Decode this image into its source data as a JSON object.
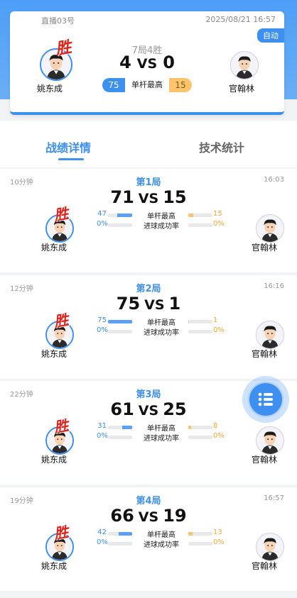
{
  "header": {
    "room": "直播03号",
    "datetime": "2025/08/21 16:57",
    "auto_badge": "自动",
    "format": "7局4胜",
    "left_player": "姚东成",
    "right_player": "官翰林",
    "left_score": "4",
    "vs": "VS",
    "right_score": "0",
    "win_mark": "胜",
    "highest_break_label": "单杆最高",
    "left_highest_break": "75",
    "right_highest_break": "15"
  },
  "tabs": [
    {
      "label": "战绩详情",
      "active": true
    },
    {
      "label": "技术统计",
      "active": false
    }
  ],
  "stat_labels": {
    "highest_break": "单杆最高",
    "pot_success": "进球成功率"
  },
  "games": [
    {
      "title": "第1局",
      "duration": "10分钟",
      "time": "16:03",
      "left_score": "71",
      "right_score": "15",
      "left_break": "47",
      "right_break": "15",
      "left_break_fill": 0.63,
      "right_break_fill": 0.2,
      "left_pot": "0%",
      "right_pot": "0%",
      "winner": "left",
      "left_player": "姚东成",
      "right_player": "官翰林"
    },
    {
      "title": "第2局",
      "duration": "12分钟",
      "time": "16:16",
      "left_score": "75",
      "right_score": "1",
      "left_break": "75",
      "right_break": "1",
      "left_break_fill": 1.0,
      "right_break_fill": 0.02,
      "left_pot": "0%",
      "right_pot": "0%",
      "winner": "left",
      "left_player": "姚东成",
      "right_player": "官翰林"
    },
    {
      "title": "第3局",
      "duration": "22分钟",
      "time": "",
      "left_score": "61",
      "right_score": "25",
      "left_break": "31",
      "right_break": "8",
      "left_break_fill": 0.41,
      "right_break_fill": 0.11,
      "left_pot": "0%",
      "right_pot": "0%",
      "winner": "left",
      "left_player": "姚东成",
      "right_player": "官翰林"
    },
    {
      "title": "第4局",
      "duration": "19分钟",
      "time": "16:57",
      "left_score": "66",
      "right_score": "19",
      "left_break": "42",
      "right_break": "13",
      "left_break_fill": 0.56,
      "right_break_fill": 0.17,
      "left_pot": "0%",
      "right_pot": "0%",
      "winner": "left",
      "left_player": "姚东成",
      "right_player": "官翰林"
    }
  ],
  "icons": {
    "menu": "list-menu-icon",
    "avatar": "player-avatar-icon"
  },
  "colors": {
    "accent": "#3d8ff0",
    "opponent": "#ffc46b",
    "win": "#e0231a"
  }
}
